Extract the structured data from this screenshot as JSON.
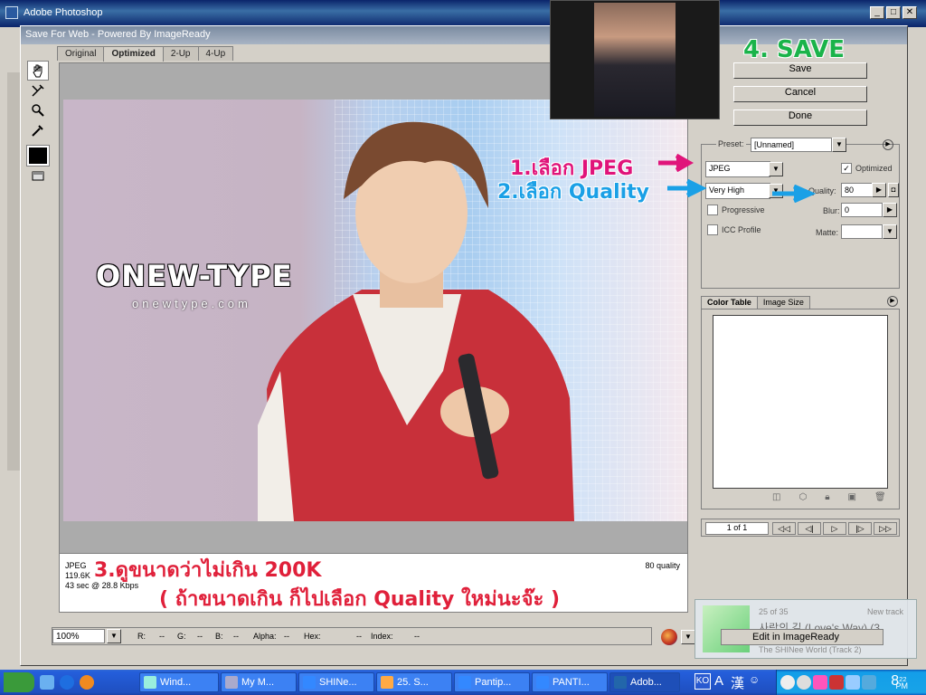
{
  "app": {
    "title": "Adobe Photoshop"
  },
  "dialog": {
    "title": "Save For Web - Powered By ImageReady",
    "tabs": [
      "Original",
      "Optimized",
      "2-Up",
      "4-Up"
    ],
    "active_tab": "Optimized"
  },
  "buttons": {
    "save": "Save",
    "cancel": "Cancel",
    "done": "Done"
  },
  "settings": {
    "preset_label": "Preset:",
    "preset_value": "[Unnamed]",
    "format": "JPEG",
    "optimized_label": "Optimized",
    "optimized_checked": true,
    "quality_preset": "Very High",
    "quality_label": "Quality:",
    "quality_value": "80",
    "progressive_label": "Progressive",
    "icc_label": "ICC Profile",
    "blur_label": "Blur:",
    "blur_value": "0",
    "matte_label": "Matte:"
  },
  "color_tabs": [
    "Color Table",
    "Image Size"
  ],
  "animation": {
    "frame_label": "1 of 1"
  },
  "info": {
    "format": "JPEG",
    "size": "119.6K",
    "download": "43 sec @ 28.8 Kbps",
    "quality": "80 quality"
  },
  "status": {
    "zoom": "100%",
    "r": "R:",
    "r_val": "--",
    "g": "G:",
    "g_val": "--",
    "b": "B:",
    "b_val": "--",
    "alpha": "Alpha:",
    "alpha_val": "--",
    "hex": "Hex:",
    "hex_val": "--",
    "index": "Index:",
    "index_val": "--"
  },
  "photo": {
    "watermark_main": "ONEW-TYPE",
    "watermark_sub": "onewtype.com"
  },
  "annotations": {
    "step1": "1.เลือก JPEG",
    "step2": "2.เลือก Quality",
    "step3": "3.ดูขนาดว่าไม่เกิน 200K",
    "step3_note": "( ถ้าขนาดเกิน ก็ไปเลือก Quality ใหม่นะจ๊ะ )",
    "step4": "4. SAVE"
  },
  "toast": {
    "track": "25 of 35",
    "new_track": "New track",
    "title": "사랑의 길 (Love's Way) (3",
    "album": "The SHINee World (Track 2)",
    "edit_label": "Edit in ImageReady"
  },
  "taskbar": {
    "items": [
      "Wind...",
      "My M...",
      "SHINe...",
      "25. S...",
      "Pantip...",
      "PANTI...",
      "Adob..."
    ],
    "lang": "KO",
    "clock_hour": "8",
    "clock_min": "22",
    "clock_ampm": "PM"
  },
  "colors": {
    "annotation_pink": "#e0147a",
    "annotation_blue": "#1aa0e6",
    "annotation_red": "#e0203a",
    "annotation_green": "#1ab34a",
    "taskbar_blue": "#245edb"
  }
}
